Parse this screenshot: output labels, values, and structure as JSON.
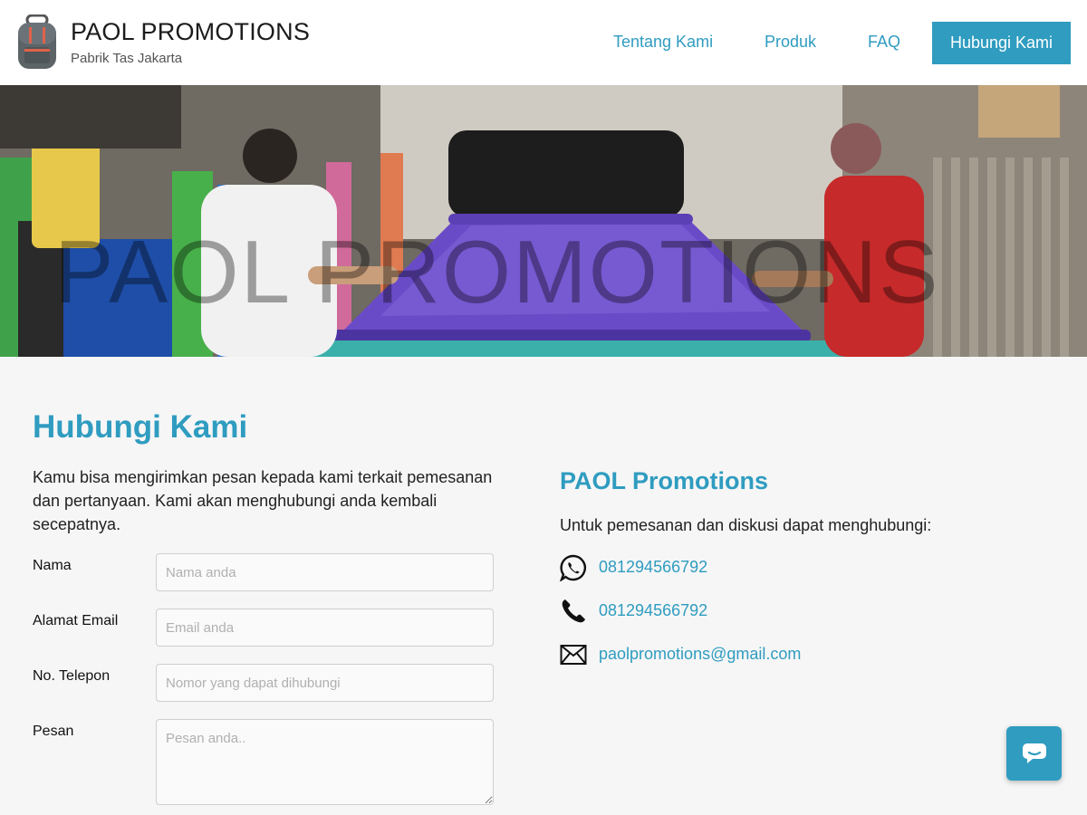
{
  "header": {
    "brand_title": "PAOL PROMOTIONS",
    "brand_subtitle": "Pabrik Tas Jakarta",
    "logo_icon": "backpack-icon",
    "nav": {
      "about": "Tentang Kami",
      "products": "Produk",
      "faq": "FAQ",
      "contact": "Hubungi Kami"
    }
  },
  "hero": {
    "watermark": "PAOL PROMOTIONS"
  },
  "contact_form": {
    "title": "Hubungi Kami",
    "intro": "Kamu bisa mengirimkan pesan kepada kami terkait pemesanan dan pertanyaan. Kami akan menghubungi anda kembali secepatnya.",
    "fields": {
      "name": {
        "label": "Nama",
        "placeholder": "Nama anda",
        "value": ""
      },
      "email": {
        "label": "Alamat Email",
        "placeholder": "Email anda",
        "value": ""
      },
      "phone": {
        "label": "No. Telepon",
        "placeholder": "Nomor yang dapat dihubungi",
        "value": ""
      },
      "message": {
        "label": "Pesan",
        "placeholder": "Pesan anda..",
        "value": ""
      }
    }
  },
  "company_info": {
    "title": "PAOL Promotions",
    "description": "Untuk pemesanan dan diskusi dapat menghubungi:",
    "whatsapp": "081294566792",
    "phone": "081294566792",
    "email": "paolpromotions@gmail.com"
  },
  "chat_widget": {
    "icon": "chat-bubble-icon"
  },
  "colors": {
    "accent": "#2f9cc0",
    "background": "#f6f6f6",
    "header_bg": "#ffffff"
  }
}
